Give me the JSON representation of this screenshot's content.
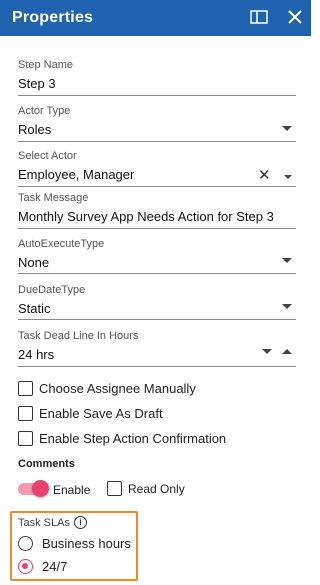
{
  "panel": {
    "title": "Properties"
  },
  "fields": {
    "step_name": {
      "label": "Step Name",
      "value": "Step 3"
    },
    "actor_type": {
      "label": "Actor Type",
      "value": "Roles"
    },
    "select_actor": {
      "label": "Select Actor",
      "value": "Employee, Manager"
    },
    "task_message": {
      "label": "Task Message",
      "value": "Monthly Survey App Needs Action for Step 3"
    },
    "auto_execute_type": {
      "label": "AutoExecuteType",
      "value": "None"
    },
    "due_date_type": {
      "label": "DueDateType",
      "value": "Static"
    },
    "task_dead_line": {
      "label": "Task Dead Line In Hours",
      "value": "24 hrs"
    }
  },
  "checkboxes": {
    "choose_assignee": {
      "label": "Choose Assignee Manually",
      "checked": false
    },
    "enable_save_draft": {
      "label": "Enable Save As Draft",
      "checked": false
    },
    "enable_step_action": {
      "label": "Enable Step Action Confirmation",
      "checked": false
    }
  },
  "comments": {
    "title": "Comments",
    "enable_label": "Enable",
    "enable_on": true,
    "read_only_label": "Read Only",
    "read_only_checked": false
  },
  "task_slas": {
    "title": "Task SLAs",
    "info_glyph": "i",
    "options": [
      {
        "label": "Business hours",
        "selected": false
      },
      {
        "label": "24/7",
        "selected": true
      }
    ]
  },
  "colors": {
    "header": "#1e62b0",
    "accent_pink": "#e8416b",
    "highlight_orange": "#f08a24"
  }
}
